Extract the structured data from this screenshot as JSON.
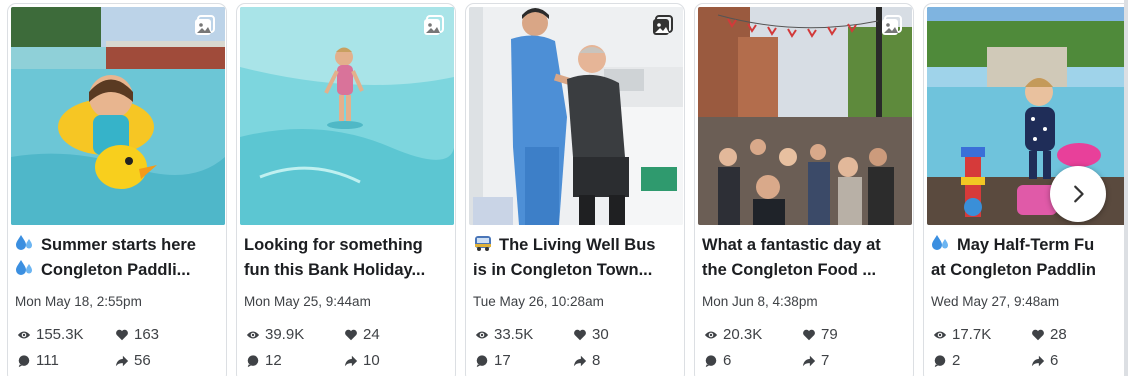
{
  "posts": [
    {
      "title_line1": "Summer starts here",
      "title_line2": "Congleton Paddli...",
      "emoji": "droplets-emoji",
      "date": "Mon May 18, 2:55pm",
      "views": "155.3K",
      "likes": "163",
      "comments": "111",
      "shares": "56",
      "media": "photo"
    },
    {
      "title_line1": "Looking for something",
      "title_line2": "fun this Bank Holiday...",
      "emoji": "",
      "date": "Mon May 25, 9:44am",
      "views": "39.9K",
      "likes": "24",
      "comments": "12",
      "shares": "10",
      "media": "photo"
    },
    {
      "title_line1": "The Living Well Bus",
      "title_line2": "is in Congleton Town...",
      "emoji": "bus-emoji",
      "date": "Tue May 26, 10:28am",
      "views": "33.5K",
      "likes": "30",
      "comments": "17",
      "shares": "8",
      "media": "photo"
    },
    {
      "title_line1": "What a fantastic day at",
      "title_line2": "the Congleton Food ...",
      "emoji": "",
      "date": "Mon Jun 8, 4:38pm",
      "views": "20.3K",
      "likes": "79",
      "comments": "6",
      "shares": "7",
      "media": "photo"
    },
    {
      "title_line1": "May Half-Term Fu",
      "title_line2": "at Congleton Paddlin",
      "emoji": "droplets-emoji",
      "date": "Wed May 27, 9:48am",
      "views": "17.7K",
      "likes": "28",
      "comments": "2",
      "shares": "6",
      "media": "photo"
    }
  ],
  "icons": {
    "views": "eye-icon",
    "likes": "heart-icon",
    "comments": "comment-icon",
    "shares": "share-arrow-icon",
    "media_badge": "photo-gallery-icon",
    "next": "chevron-right-icon"
  },
  "colors": {
    "text": "#1c1e21",
    "muted": "#3f4246",
    "border": "#dcdfe3"
  }
}
